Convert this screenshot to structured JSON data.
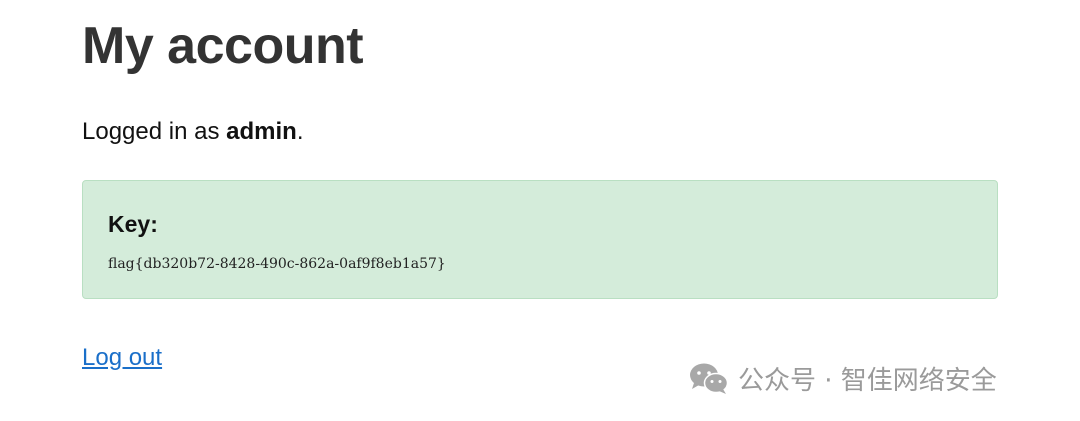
{
  "page": {
    "title": "My account"
  },
  "account": {
    "status_prefix": "Logged in as ",
    "username": "admin",
    "status_suffix": "."
  },
  "key_box": {
    "heading": "Key:",
    "value": "flag{db320b72-8428-490c-862a-0af9f8eb1a57}"
  },
  "actions": {
    "logout_label": "Log out"
  },
  "watermark": {
    "icon": "wechat-icon",
    "text": "公众号 · 智佳网络安全"
  },
  "colors": {
    "key_box_bg": "#d4ecda",
    "link": "#1a6fc9"
  }
}
